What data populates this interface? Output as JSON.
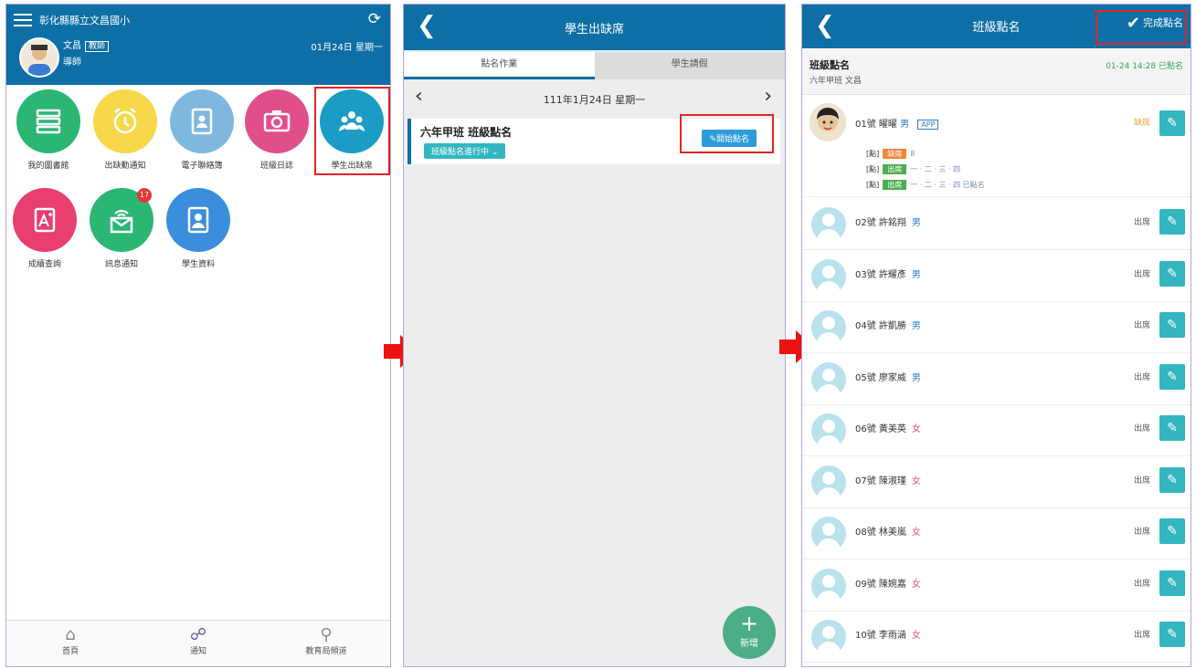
{
  "phone1": {
    "school_name": "彰化縣縣立文昌國小",
    "user_name": "文昌",
    "user_tag": "教師",
    "user_role": "導師",
    "date": "01月24日 星期一",
    "apps": [
      {
        "label": "我的圖書館"
      },
      {
        "label": "出缺勤通知"
      },
      {
        "label": "電子聯絡簿"
      },
      {
        "label": "班級日誌"
      },
      {
        "label": "學生出缺席"
      },
      {
        "label": "成績查詢"
      },
      {
        "label": "訊息通知"
      },
      {
        "label": "學生資料"
      }
    ],
    "badge_count": "17",
    "nav": [
      {
        "label": "首頁"
      },
      {
        "label": "通知"
      },
      {
        "label": "教育局頻道"
      }
    ],
    "colors": {
      "header": "#0d6fa5",
      "highlight": "#e02424"
    }
  },
  "phone2": {
    "title": "學生出缺席",
    "tabs": [
      {
        "label": "點名作業"
      },
      {
        "label": "學生請假"
      }
    ],
    "date": "111年1月24日 星期一",
    "card_title": "六年甲班 班級點名",
    "card_status": "班級點名進行中",
    "rollcall_button": "開始點名",
    "fab_label": "新增"
  },
  "phone3": {
    "title": "班級點名",
    "done_button": "完成點名",
    "info_title": "班級點名",
    "info_class": "六年甲班 文昌",
    "info_time": "01-24 14:28 已點名",
    "first": {
      "number": "01號",
      "name": "曜曜",
      "gender": "男",
      "app_tag": "APP",
      "status": "缺席",
      "logs": [
        {
          "prefix": "[點]",
          "tag": "缺席",
          "text": "8",
          "color": "#f0873a"
        },
        {
          "prefix": "[點]",
          "tag": "出席",
          "text": "一 · 二 · 三 · 四",
          "color": "#4caf50"
        },
        {
          "prefix": "[點]",
          "tag": "出席",
          "text": "一 · 二 · 三 · 四 已點名",
          "color": "#4caf50"
        }
      ]
    },
    "students": [
      {
        "number": "02號",
        "name": "許銘翔",
        "gender": "男",
        "gcls": "male",
        "status": "出席"
      },
      {
        "number": "03號",
        "name": "許耀彥",
        "gender": "男",
        "gcls": "male",
        "status": "出席"
      },
      {
        "number": "04號",
        "name": "許凱勝",
        "gender": "男",
        "gcls": "male",
        "status": "出席"
      },
      {
        "number": "05號",
        "name": "廖家威",
        "gender": "男",
        "gcls": "male",
        "status": "出席"
      },
      {
        "number": "06號",
        "name": "黃美英",
        "gender": "女",
        "gcls": "female",
        "status": "出席"
      },
      {
        "number": "07號",
        "name": "陳淑瑾",
        "gender": "女",
        "gcls": "female",
        "status": "出席"
      },
      {
        "number": "08號",
        "name": "林美嵐",
        "gender": "女",
        "gcls": "female",
        "status": "出席"
      },
      {
        "number": "09號",
        "name": "陳婉嘉",
        "gender": "女",
        "gcls": "female",
        "status": "出席"
      },
      {
        "number": "10號",
        "name": "李雨涵",
        "gender": "女",
        "gcls": "female",
        "status": "出席"
      }
    ]
  }
}
